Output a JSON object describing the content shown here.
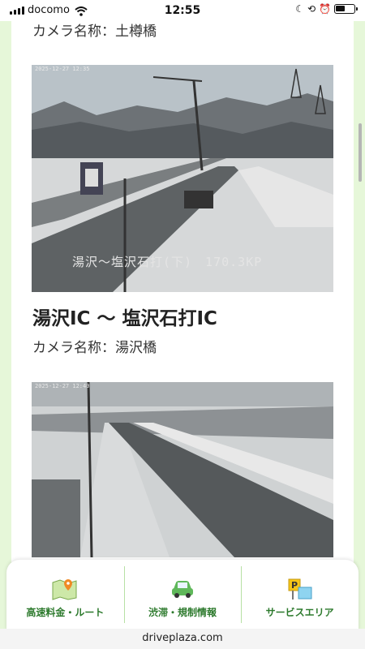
{
  "status_bar": {
    "carrier": "docomo",
    "time": "12:55"
  },
  "cameras": [
    {
      "name_label": "カメラ名称：土樽橋"
    },
    {
      "timestamp": "2025-12-27 12:35",
      "overlay_text": "湯沢～塩沢石打(下)　170.3KP"
    },
    {
      "section_title": "湯沢IC 〜 塩沢石打IC",
      "name_label": "カメラ名称：湯沢橋",
      "timestamp": "2025-12-27 12:40"
    }
  ],
  "bottom_nav": {
    "items": [
      {
        "label": "高速料金・ルート",
        "icon": "map-pin-icon"
      },
      {
        "label": "渋滞・規制情報",
        "icon": "car-icon"
      },
      {
        "label": "サービスエリア",
        "icon": "parking-icon"
      }
    ]
  },
  "browser": {
    "url": "driveplaza.com"
  },
  "colors": {
    "frame": "#e6f7d9",
    "nav_label": "#2d7a2d",
    "nav_divider": "#b7e0a4"
  }
}
